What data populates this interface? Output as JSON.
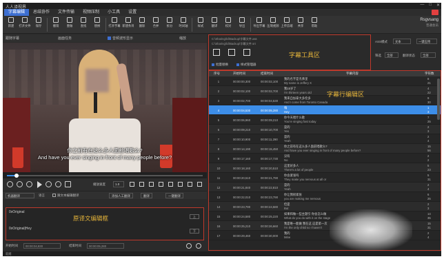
{
  "title_bar": {
    "app_title": "人人译视界",
    "controls": [
      "—",
      "□",
      "✕"
    ]
  },
  "menu": [
    "字幕编辑",
    "总结协作",
    "文件传输",
    "视频压制",
    "小工具",
    "设置"
  ],
  "toolbar": [
    {
      "label": "新建",
      "icon": "new-icon"
    },
    {
      "label": "打开文件",
      "icon": "open-icon"
    },
    {
      "label": "保存",
      "icon": "save-icon"
    },
    {
      "label": "撤销",
      "icon": "undo-icon"
    },
    {
      "label": "重做",
      "icon": "redo-icon"
    },
    {
      "label": "查找",
      "icon": "find-icon"
    },
    {
      "label": "替换",
      "icon": "replace-icon"
    },
    {
      "label": "打开字幕",
      "icon": "open-sub-icon"
    },
    {
      "label": "新建条目",
      "icon": "add-row-icon"
    },
    {
      "label": "删除",
      "icon": "delete-icon"
    },
    {
      "label": "合并",
      "icon": "merge-icon"
    },
    {
      "label": "拆分",
      "icon": "split-icon"
    },
    {
      "label": "时间轴",
      "icon": "timeline-icon"
    },
    {
      "label": "样式",
      "icon": "style-icon"
    },
    {
      "label": "翻译",
      "icon": "translate-icon"
    },
    {
      "label": "校对",
      "icon": "proof-icon"
    },
    {
      "label": "导出",
      "icon": "export-icon"
    },
    {
      "label": "导出字幕",
      "icon": "export-sub-icon"
    },
    {
      "label": "压制视频",
      "icon": "render-icon"
    },
    {
      "label": "上传云端",
      "icon": "upload-icon"
    },
    {
      "label": "共享",
      "icon": "share-icon"
    },
    {
      "label": "帮助",
      "icon": "help-icon"
    }
  ],
  "account": {
    "name": "Rsgvsang",
    "sub": "普通会员"
  },
  "video_header": {
    "sync": "跟随字幕",
    "title": "画面任务",
    "waveform": "音频波形显示",
    "zoom": "缩放"
  },
  "subtitle_overlay": {
    "cn": "你之前有在这么多人面前唱歌么?",
    "en": "And have you ever singing in front of many people before?"
  },
  "progress": {
    "position": 0.05,
    "time": "00:00:04,930"
  },
  "playback": {
    "speed_label": "播放速度",
    "speed_value": "1.0"
  },
  "trans_header": {
    "mode": "机器翻译",
    "label": "语言",
    "check": "跟文本编辑翻译",
    "btn1": "添加人工翻译",
    "btn2": "翻译",
    "btn3": "一键翻译"
  },
  "editbox": {
    "source": "0xOriginal",
    "translation": "0xOriginal|Hey",
    "label": "原译文编辑框",
    "btn_up": "上",
    "btn_down": "下"
  },
  "statusbar": {
    "start_label": "开始时间",
    "start_val": "00:00:04,930",
    "end_label": "结束时间",
    "end_val": "00:00:05,280"
  },
  "footer": "就绪",
  "tools_box": {
    "file1": "C:\\Sharing\\lcl\\Backup\\字幕文件.ass",
    "file2": "C:\\Sharing\\lcl\\Backup\\字幕文件.srt",
    "label": "字幕工具区",
    "tab1": "批量替换",
    "tab2": "样式管理器"
  },
  "right_ctrl": {
    "mode_label": "ASS模式",
    "mode_val": "文本",
    "btn_all": "一键应用",
    "sort_label": "筛选",
    "sort_val": "全部",
    "filter_label": "翻译状态",
    "filter_val": "全部"
  },
  "table": {
    "label": "字幕行编辑区",
    "headers": [
      "序号",
      "开始时间",
      "结束时间",
      "字幕内容",
      "字符数"
    ],
    "rows": [
      {
        "no": "1",
        "st": "00:00:00,300",
        "et": "00:00:02,100",
        "cn": "我的名字是杰弗里",
        "en": "My name is Jeffery X",
        "c1": "8",
        "c2": "21"
      },
      {
        "no": "2",
        "st": "00:00:02,100",
        "et": "00:00:02,700",
        "cn": "我15岁了",
        "en": "I'm thirteen years old",
        "c1": "4",
        "c2": "22"
      },
      {
        "no": "3",
        "st": "00:00:02,700",
        "et": "00:00:04,530",
        "cn": "我来自加拿大多伦多",
        "en": "And I come from Toronto Canada",
        "c1": "9",
        "c2": "30"
      },
      {
        "no": "4",
        "st": "00:00:04,530",
        "et": "00:00:05,280",
        "cn": "嗨",
        "en": "Hey",
        "c1": "1",
        "c2": "3",
        "selected": true
      },
      {
        "no": "5",
        "st": "00:00:06,960",
        "et": "00:00:09,210",
        "cn": "你今天唱什么歌",
        "en": "You're singing fast today",
        "c1": "7",
        "c2": "25"
      },
      {
        "no": "6",
        "st": "00:00:09,210",
        "et": "00:00:10,700",
        "cn": "是的",
        "en": "Yes",
        "c1": "2",
        "c2": "3"
      },
      {
        "no": "7",
        "st": "00:00:10,900",
        "et": "00:00:11,290",
        "cn": "是的",
        "en": "Yeah",
        "c1": "2",
        "c2": "4"
      },
      {
        "no": "8",
        "st": "00:00:14,190",
        "et": "00:00:15,450",
        "cn": "你之前有在这么多人面前唱歌么?",
        "en": "And have you ever singing in front of many people before?",
        "c1": "15",
        "c2": "56"
      },
      {
        "no": "9",
        "st": "00:00:17,160",
        "et": "00:00:17,730",
        "cn": "没有",
        "en": "No",
        "c1": "2",
        "c2": "2"
      },
      {
        "no": "10",
        "st": "00:00:18,160",
        "et": "00:00:20,510",
        "cn": "这里好多人",
        "en": "There's a lot of people",
        "c1": "5",
        "c2": "23"
      },
      {
        "no": "11",
        "st": "00:00:20,510",
        "et": "00:00:21,790",
        "cn": "你会紧张吗",
        "en": "They make you nervous at all or",
        "c1": "5",
        "c2": "31"
      },
      {
        "no": "12",
        "st": "00:00:21,840",
        "et": "00:00:22,810",
        "cn": "是的",
        "en": "Yeah",
        "c1": "2",
        "c2": "4"
      },
      {
        "no": "13",
        "st": "00:00:22,010",
        "et": "00:00:23,790",
        "cn": "你让我很紧张",
        "en": "you are making me nervous",
        "c1": "6",
        "c2": "25"
      },
      {
        "no": "14",
        "st": "00:00:23,790",
        "et": "00:00:24,580",
        "cn": "但是",
        "en": "But",
        "c1": "2",
        "c2": "3"
      },
      {
        "no": "15",
        "st": "00:00:24,580",
        "et": "00:00:25,220",
        "cn": "如果和做一些主题引 你会怎么做",
        "en": "What do you do with it on the stage",
        "c1": "14",
        "c2": "35"
      },
      {
        "no": "16",
        "st": "00:00:25,210",
        "et": "00:00:26,660",
        "cn": "我是唯一能做 我在这 这是第一次",
        "en": "I'm the only child so I haven't",
        "c1": "15",
        "c2": "31"
      },
      {
        "no": "17",
        "st": "00:00:29,460",
        "et": "00:00:30,000",
        "cn": "我的",
        "en": "Mine",
        "c1": "2",
        "c2": "4"
      }
    ]
  },
  "colors": {
    "accent": "#3d8ee8",
    "highlight_frame": "#c0392b",
    "annotation": "#e6b53a"
  }
}
